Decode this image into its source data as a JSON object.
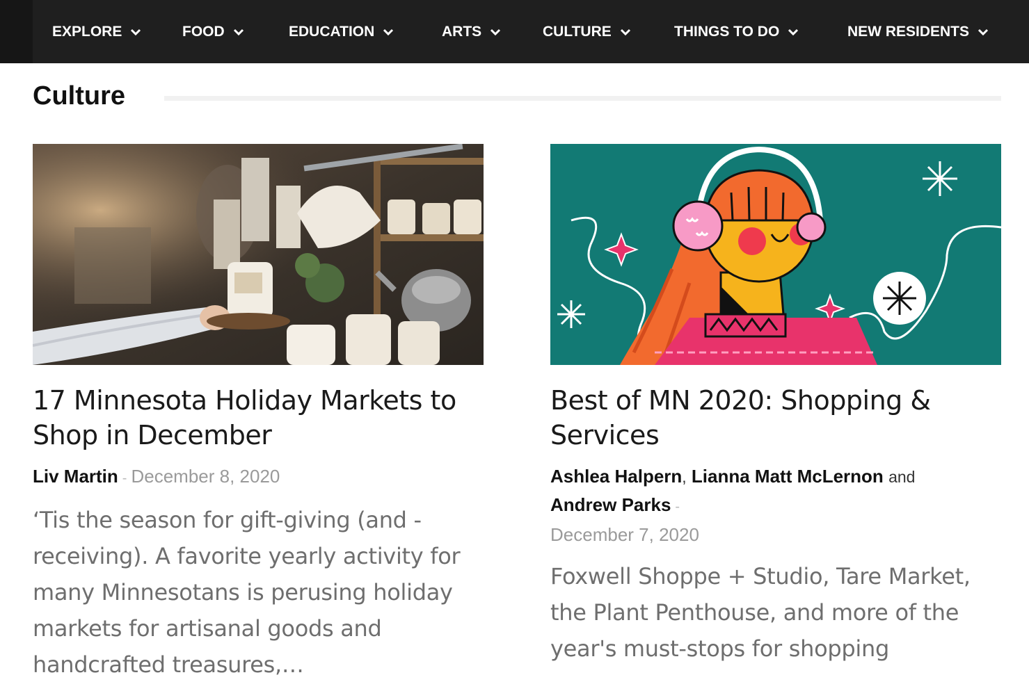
{
  "nav": {
    "items": [
      {
        "label": "EXPLORE"
      },
      {
        "label": "FOOD"
      },
      {
        "label": "EDUCATION"
      },
      {
        "label": "ARTS"
      },
      {
        "label": "CULTURE"
      },
      {
        "label": "THINGS TO DO"
      },
      {
        "label": "NEW RESIDENTS"
      }
    ],
    "chevron_icon": "chevron-down-icon"
  },
  "section": {
    "title": "Culture"
  },
  "articles": [
    {
      "title": "17 Minnesota Holiday Markets to Shop in December",
      "authors": [
        "Liv Martin"
      ],
      "separator": "-",
      "date": "December 8, 2020",
      "excerpt": "‘Tis the season for gift-giving (and -receiving). A favorite yearly activity for many Minnesotans is perusing holiday markets for artisanal goods and handcrafted treasures,…",
      "image": "holiday-market-photo"
    },
    {
      "title": "Best of MN 2020: Shopping & Services",
      "authors": [
        "Ashlea Halpern",
        "Lianna Matt McLernon",
        "Andrew Parks"
      ],
      "author_joiner_comma": ",",
      "author_joiner_and": "and",
      "separator": "-",
      "date": "December 7, 2020",
      "excerpt": "Foxwell Shoppe + Studio, Tare Market, the Plant Penthouse, and more of the year's must-stops for shopping",
      "image": "winter-illustration"
    }
  ],
  "colors": {
    "nav_bg": "#1f1f1f",
    "illustration_teal": "#127a74",
    "accent_pink": "#e8336b",
    "accent_orange": "#f26a2e",
    "accent_yellow": "#f6b31c"
  }
}
